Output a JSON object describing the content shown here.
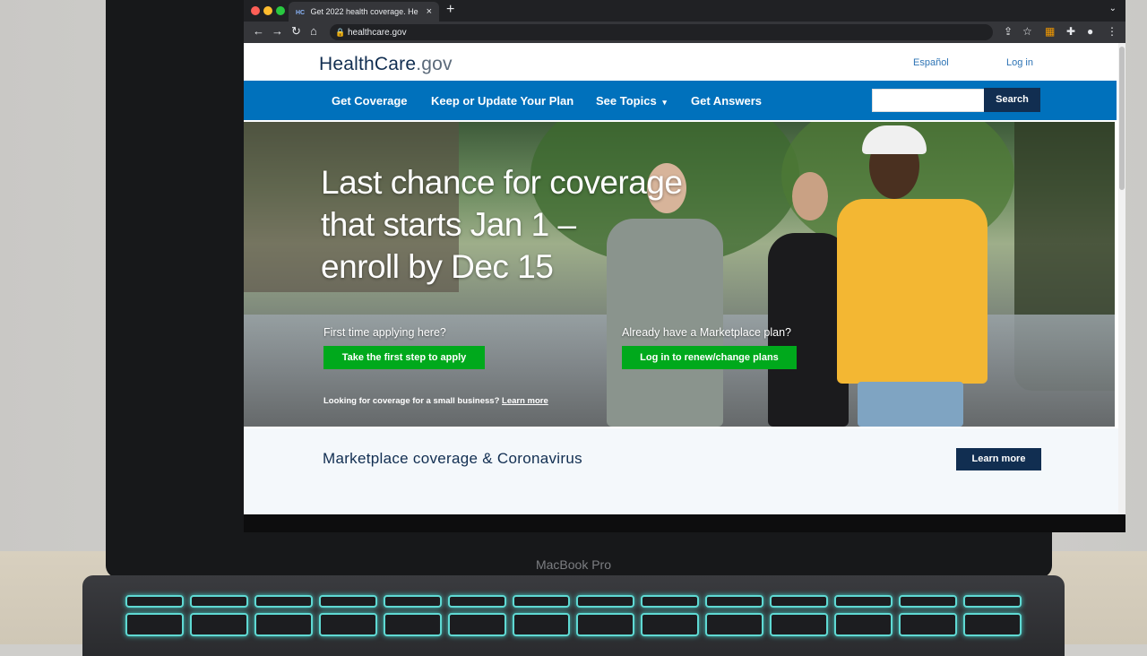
{
  "browser": {
    "tab_title": "Get 2022 health coverage. He",
    "tab_favicon": "HC",
    "tab_close_icon": "×",
    "new_tab_icon": "+",
    "url": "healthcare.gov",
    "icons": {
      "back": "←",
      "forward": "→",
      "reload": "↻",
      "home": "⌂",
      "share": "⇪",
      "bookmark": "☆",
      "puzzle": "✚",
      "profile": "●",
      "menu": "⋮",
      "tab_menu": "⌄"
    }
  },
  "site": {
    "logo_main": "HealthCare",
    "logo_gov": ".gov",
    "espanol": "Español",
    "login": "Log in",
    "nav": [
      "Get Coverage",
      "Keep or Update Your Plan",
      "See Topics",
      "Get Answers"
    ],
    "see_topics_chevron": "▾",
    "search_label": "Search",
    "search_placeholder": ""
  },
  "hero": {
    "headline_lines": [
      "Last chance for coverage",
      "that starts Jan 1 –",
      "enroll by Dec 15"
    ],
    "first_time_prompt": "First time applying here?",
    "first_step_button": "Take the first step to apply",
    "already_prompt": "Already have a Marketplace plan?",
    "login_renew_button": "Log in to renew/change plans",
    "small_business_text": "Looking for coverage for a small business?",
    "small_business_link": "Learn more"
  },
  "banner": {
    "title": "Marketplace coverage & Coronavirus",
    "learn_more": "Learn more"
  },
  "laptop": {
    "model": "MacBook Pro"
  },
  "colors": {
    "nav_blue": "#0071bc",
    "navy": "#112e51",
    "cta_green": "#00a91c"
  }
}
